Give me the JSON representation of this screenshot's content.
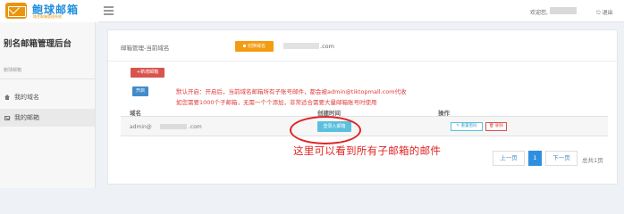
{
  "header": {
    "logo_title": "鲍球邮箱",
    "logo_subtitle": "域名邮箱管理系统",
    "welcome": "欢迎您,",
    "logout": "退出"
  },
  "sidebar": {
    "title": "别名邮箱管理后台",
    "section": "鲍球邮箱",
    "items": [
      {
        "label": "我的域名",
        "icon": "home-icon"
      },
      {
        "label": "我的邮箱",
        "icon": "mail-icon",
        "active": true
      }
    ]
  },
  "main": {
    "breadcrumb": "邮箱管理-当前域名",
    "domain_tail": ".com",
    "switch_domain": "切换域名",
    "add_mailbox": "+新增邮箱",
    "enable": "开启",
    "note_line1": "默认开启：开启后，当前域名邮箱所有子账号邮件，都会被admin@tiktopmall.com代收",
    "note_line2": "如您需要1000个子邮箱，无需一个个添加，非常适合需要大量邮箱账号时使用",
    "table": {
      "headers": [
        "域名",
        "创建时间",
        "操作"
      ],
      "rows": [
        {
          "user_prefix": "admin@",
          "user_tail": ".com",
          "enter": "登录入邮箱",
          "reset": "重置密码",
          "delete": "删除"
        }
      ]
    },
    "annotation": "这里可以看到所有子邮箱的邮件",
    "pagination": {
      "prev": "上一页",
      "current": "1",
      "next": "下一页",
      "total": "总共1页"
    }
  },
  "colors": {
    "accent_blue": "#2e8fe0",
    "orange": "#f39c12",
    "danger": "#d9534f",
    "annotation_red": "#e02424",
    "info": "#5bc0de"
  }
}
